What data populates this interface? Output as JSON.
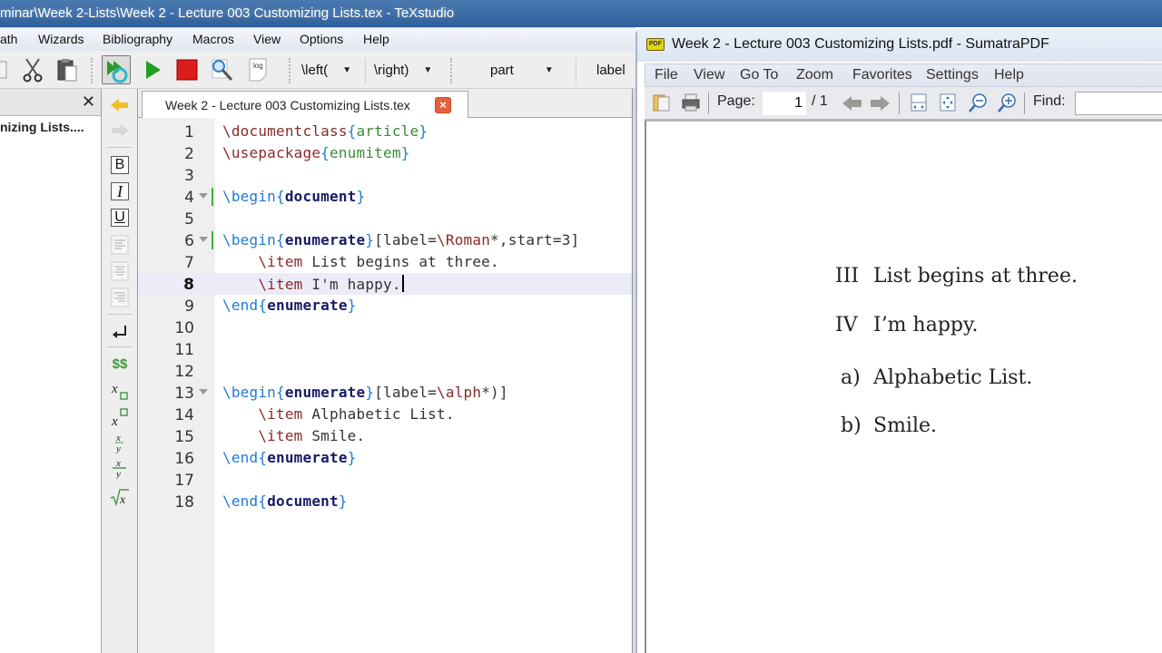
{
  "texstudio": {
    "title": "minar\\Week 2-Lists\\Week 2 - Lecture 003 Customizing Lists.tex - TeXstudio",
    "menu": [
      {
        "label": "ath"
      },
      {
        "label": "Wizards"
      },
      {
        "label": "Bibliography"
      },
      {
        "label": "Macros"
      },
      {
        "label": "View"
      },
      {
        "label": "Options"
      },
      {
        "label": "Help"
      }
    ],
    "toolbar": {
      "icons": [
        "copy-icon",
        "cut-icon",
        "paste-icon",
        "build-and-view-icon",
        "compile-icon",
        "stop-icon",
        "view-pdf-icon",
        "view-log-icon"
      ],
      "left_combo": "\\left(",
      "right_combo": "\\right)",
      "sectioning_combo": "part",
      "label_button": "label",
      "log_icon_text": "log"
    },
    "structure": {
      "item": "nizing Lists...."
    },
    "side_tools": {
      "bold": "B",
      "italic": "I",
      "underline": "U",
      "dollars": "$$"
    },
    "tab": {
      "label": "Week 2 - Lecture 003 Customizing Lists.tex",
      "close": "×"
    },
    "editor": {
      "current_line": 8,
      "lines": [
        {
          "n": "1",
          "fold": false,
          "tokens": [
            [
              "cmd",
              "\\documentclass"
            ],
            [
              "brk",
              "{"
            ],
            [
              "arg",
              "article"
            ],
            [
              "brk",
              "}"
            ]
          ]
        },
        {
          "n": "2",
          "fold": false,
          "tokens": [
            [
              "cmd",
              "\\usepackage"
            ],
            [
              "brk",
              "{"
            ],
            [
              "arg",
              "enumitem"
            ],
            [
              "brk",
              "}"
            ]
          ]
        },
        {
          "n": "3",
          "fold": false,
          "tokens": []
        },
        {
          "n": "4",
          "fold": true,
          "tokens": [
            [
              "env",
              "\\begin"
            ],
            [
              "brk",
              "{"
            ],
            [
              "envname",
              "document"
            ],
            [
              "brk",
              "}"
            ]
          ]
        },
        {
          "n": "5",
          "fold": false,
          "tokens": []
        },
        {
          "n": "6",
          "fold": true,
          "tokens": [
            [
              "env",
              "\\begin"
            ],
            [
              "brk",
              "{"
            ],
            [
              "envname",
              "enumerate"
            ],
            [
              "brk",
              "}"
            ],
            [
              "opt",
              "[label="
            ],
            [
              "cmd",
              "\\Roman"
            ],
            [
              "opt",
              "*,start=3]"
            ]
          ]
        },
        {
          "n": "7",
          "fold": false,
          "tokens": [
            [
              "opt",
              "    "
            ],
            [
              "cmd",
              "\\item"
            ],
            [
              "opt",
              " List begins at three."
            ]
          ]
        },
        {
          "n": "8",
          "fold": false,
          "tokens": [
            [
              "opt",
              "    "
            ],
            [
              "cmd",
              "\\item"
            ],
            [
              "opt",
              " I'm happy."
            ]
          ]
        },
        {
          "n": "9",
          "fold": false,
          "tokens": [
            [
              "env",
              "\\end"
            ],
            [
              "brk",
              "{"
            ],
            [
              "envname",
              "enumerate"
            ],
            [
              "brk",
              "}"
            ]
          ]
        },
        {
          "n": "10",
          "fold": false,
          "tokens": []
        },
        {
          "n": "11",
          "fold": false,
          "tokens": []
        },
        {
          "n": "12",
          "fold": false,
          "tokens": []
        },
        {
          "n": "13",
          "fold": true,
          "tokens": [
            [
              "env",
              "\\begin"
            ],
            [
              "brk",
              "{"
            ],
            [
              "envname",
              "enumerate"
            ],
            [
              "brk",
              "}"
            ],
            [
              "opt",
              "[label="
            ],
            [
              "cmd",
              "\\alph"
            ],
            [
              "opt",
              "*)]"
            ]
          ]
        },
        {
          "n": "14",
          "fold": false,
          "tokens": [
            [
              "opt",
              "    "
            ],
            [
              "cmd",
              "\\item"
            ],
            [
              "opt",
              " Alphabetic List."
            ]
          ]
        },
        {
          "n": "15",
          "fold": false,
          "tokens": [
            [
              "opt",
              "    "
            ],
            [
              "cmd",
              "\\item"
            ],
            [
              "opt",
              " Smile."
            ]
          ]
        },
        {
          "n": "16",
          "fold": false,
          "tokens": [
            [
              "env",
              "\\end"
            ],
            [
              "brk",
              "{"
            ],
            [
              "envname",
              "enumerate"
            ],
            [
              "brk",
              "}"
            ]
          ]
        },
        {
          "n": "17",
          "fold": false,
          "tokens": []
        },
        {
          "n": "18",
          "fold": false,
          "tokens": [
            [
              "env",
              "\\end"
            ],
            [
              "brk",
              "{"
            ],
            [
              "envname",
              "document"
            ],
            [
              "brk",
              "}"
            ]
          ]
        }
      ]
    }
  },
  "sumatra": {
    "title": "Week 2 - Lecture 003 Customizing Lists.pdf - SumatraPDF",
    "logo_text": "PDF",
    "menu": [
      {
        "label": "File"
      },
      {
        "label": "View"
      },
      {
        "label": "Go To"
      },
      {
        "label": "Zoom"
      },
      {
        "label": "Favorites"
      },
      {
        "label": "Settings"
      },
      {
        "label": "Help"
      }
    ],
    "toolbar": {
      "page_label": "Page:",
      "page_value": "1",
      "page_total": "/ 1",
      "find_label": "Find:",
      "find_value": ""
    },
    "document": {
      "items": [
        {
          "label": "III",
          "text": "List begins at three."
        },
        {
          "label": "IV",
          "text": "I’m happy."
        },
        {
          "label": "a)",
          "text": "Alphabetic List."
        },
        {
          "label": "b)",
          "text": "Smile."
        }
      ]
    }
  }
}
